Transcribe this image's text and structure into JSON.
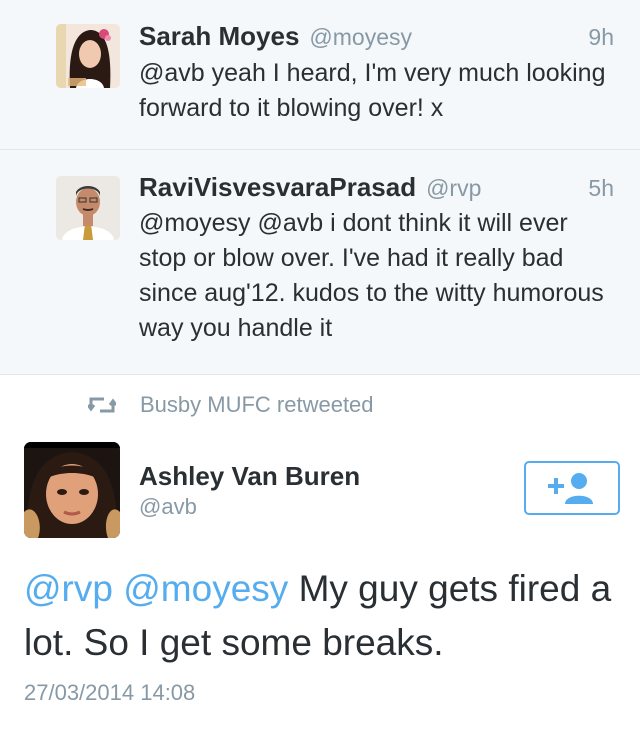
{
  "replies": [
    {
      "name": "Sarah Moyes",
      "handle": "@moyesy",
      "time": "9h",
      "text": "@avb yeah I heard, I'm very much looking forward to it blowing over! x"
    },
    {
      "name": "RaviVisvesvaraPrasad",
      "handle": "@rvp",
      "time": "5h",
      "text": "@moyesy @avb i dont think it will ever stop or blow over. I've had it really bad since aug'12. kudos to the witty humorous way you handle it"
    }
  ],
  "retweet_label": "Busby MUFC retweeted",
  "main_tweet": {
    "name": "Ashley Van Buren",
    "handle": "@avb",
    "mention1": "@rvp",
    "mention2": "@moyesy",
    "text": "My guy gets fired a lot. So I get some breaks.",
    "timestamp": "27/03/2014 14:08"
  },
  "icons": {
    "retweet": "retweet-icon",
    "follow": "add-user-icon"
  },
  "colors": {
    "accent": "#55acee",
    "muted": "#8899a6",
    "text": "#292f33",
    "reply_bg": "#f5f8fa"
  }
}
